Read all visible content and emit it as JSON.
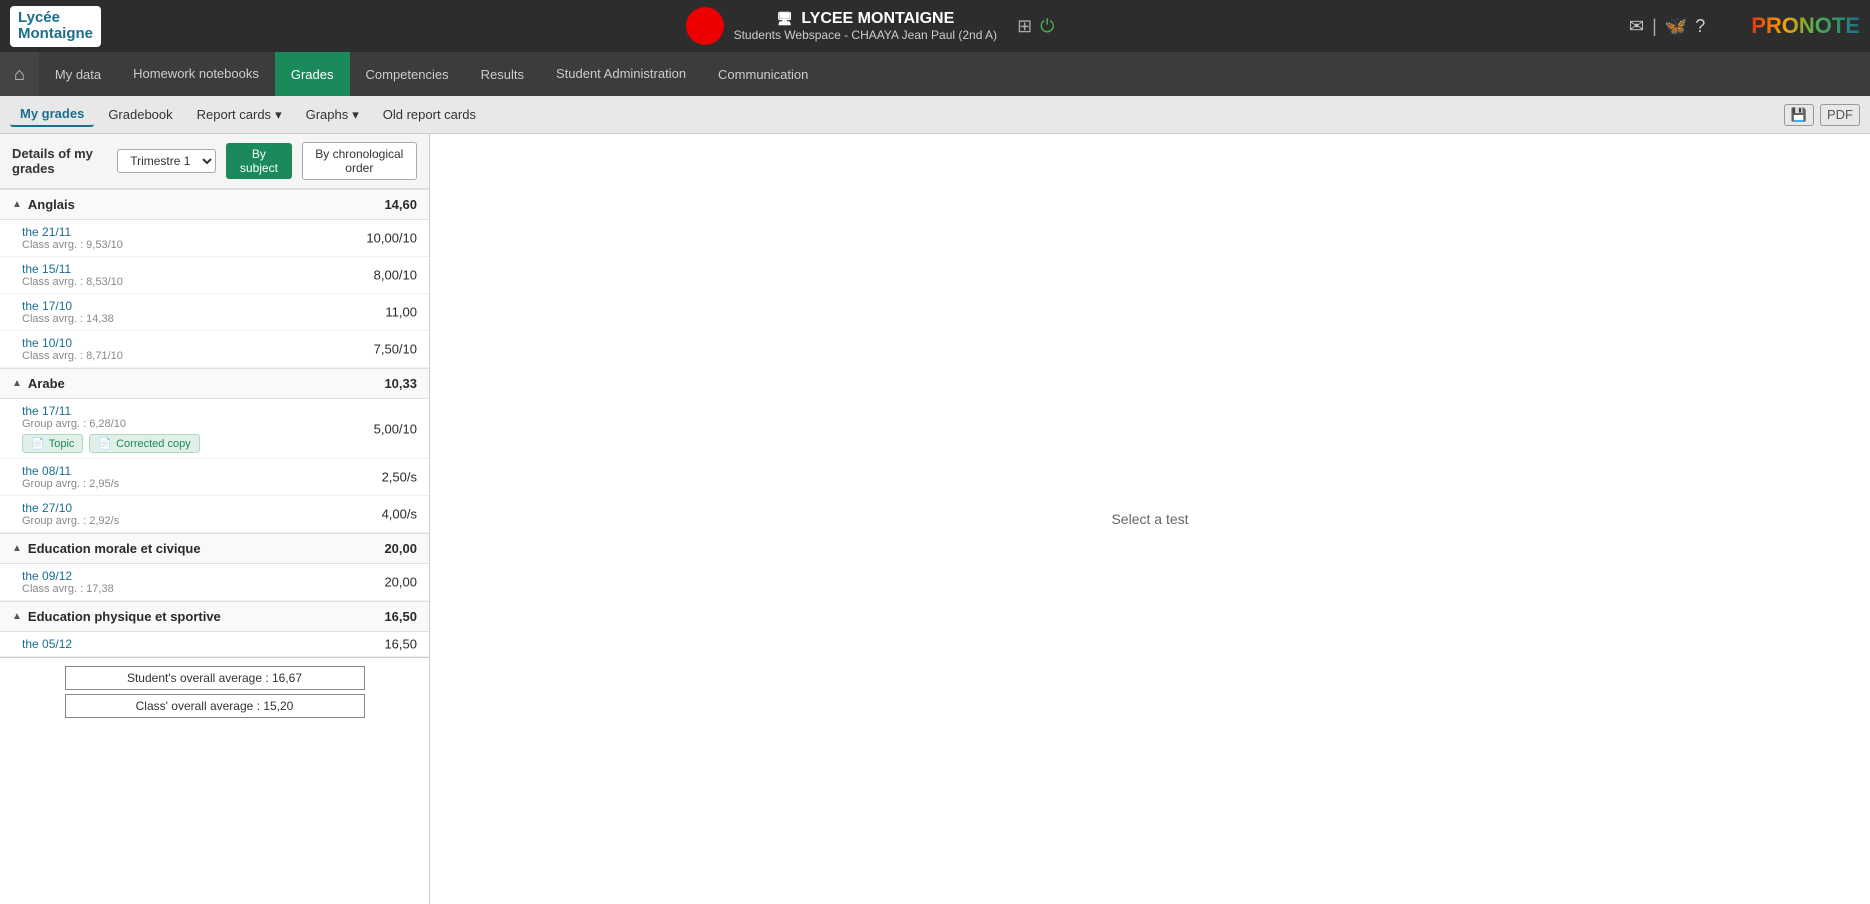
{
  "school": {
    "logo_line1": "Lycée",
    "logo_line2": "Montaigne",
    "name": "LYCEE MONTAIGNE",
    "student_info": "Students Webspace - CHAAYA Jean Paul (2nd A)"
  },
  "pronote": "PRONOTE",
  "nav": {
    "home_icon": "⌂",
    "items": [
      {
        "label": "My data",
        "active": false
      },
      {
        "label": "Homework notebooks",
        "active": false
      },
      {
        "label": "Grades",
        "active": true
      },
      {
        "label": "Competencies",
        "active": false
      },
      {
        "label": "Results",
        "active": false
      },
      {
        "label": "Student Administration",
        "active": false
      },
      {
        "label": "Communication",
        "active": false
      }
    ]
  },
  "sub_nav": {
    "items": [
      {
        "label": "My grades",
        "active": true
      },
      {
        "label": "Gradebook",
        "active": false
      },
      {
        "label": "Report cards",
        "active": false,
        "has_arrow": true
      },
      {
        "label": "Graphs",
        "active": false,
        "has_arrow": true
      },
      {
        "label": "Old report cards",
        "active": false
      }
    ]
  },
  "details": {
    "title": "Details of my grades",
    "trimestre": "Trimestre 1",
    "btn_subject": "By subject",
    "btn_chrono": "By chronological order"
  },
  "subjects": [
    {
      "name": "Anglais",
      "avg": "14,60",
      "collapsed": false,
      "grades": [
        {
          "date": "the 21/11",
          "avg_label": "Class avrg. : 9,53/10",
          "score": "10,00/10"
        },
        {
          "date": "the 15/11",
          "avg_label": "Class avrg. : 8,53/10",
          "score": "8,00/10"
        },
        {
          "date": "the 17/10",
          "avg_label": "Class avrg. : 14,38",
          "score": "11,00"
        },
        {
          "date": "the 10/10",
          "avg_label": "Class avrg. : 8,71/10",
          "score": "7,50/10"
        }
      ]
    },
    {
      "name": "Arabe",
      "avg": "10,33",
      "collapsed": false,
      "grades": [
        {
          "date": "the 17/11",
          "avg_label": "Group avrg. : 6,28/10",
          "score": "5,00/10",
          "buttons": [
            {
              "label": "Topic",
              "icon": "📄"
            },
            {
              "label": "Corrected copy",
              "icon": "📄"
            }
          ]
        },
        {
          "date": "the 08/11",
          "avg_label": "Group avrg. : 2,95/s",
          "score": "2,50/s"
        },
        {
          "date": "the 27/10",
          "avg_label": "Group avrg. : 2,92/s",
          "score": "4,00/s"
        }
      ]
    },
    {
      "name": "Education morale et civique",
      "avg": "20,00",
      "collapsed": false,
      "grades": [
        {
          "date": "the 09/12",
          "avg_label": "Class avrg. : 17,38",
          "score": "20,00"
        }
      ]
    },
    {
      "name": "Education physique et sportive",
      "avg": "16,50",
      "collapsed": false,
      "grades": [
        {
          "date": "the 05/12",
          "avg_label": "",
          "score": "16,50"
        }
      ]
    }
  ],
  "overall": {
    "student_label": "Student's overall average : 16,67",
    "class_label": "Class' overall average : 15,20"
  },
  "right_panel": {
    "placeholder": "Select a test"
  },
  "top_right_icons": {
    "send": "✉",
    "butterfly": "🦋",
    "help": "?"
  }
}
